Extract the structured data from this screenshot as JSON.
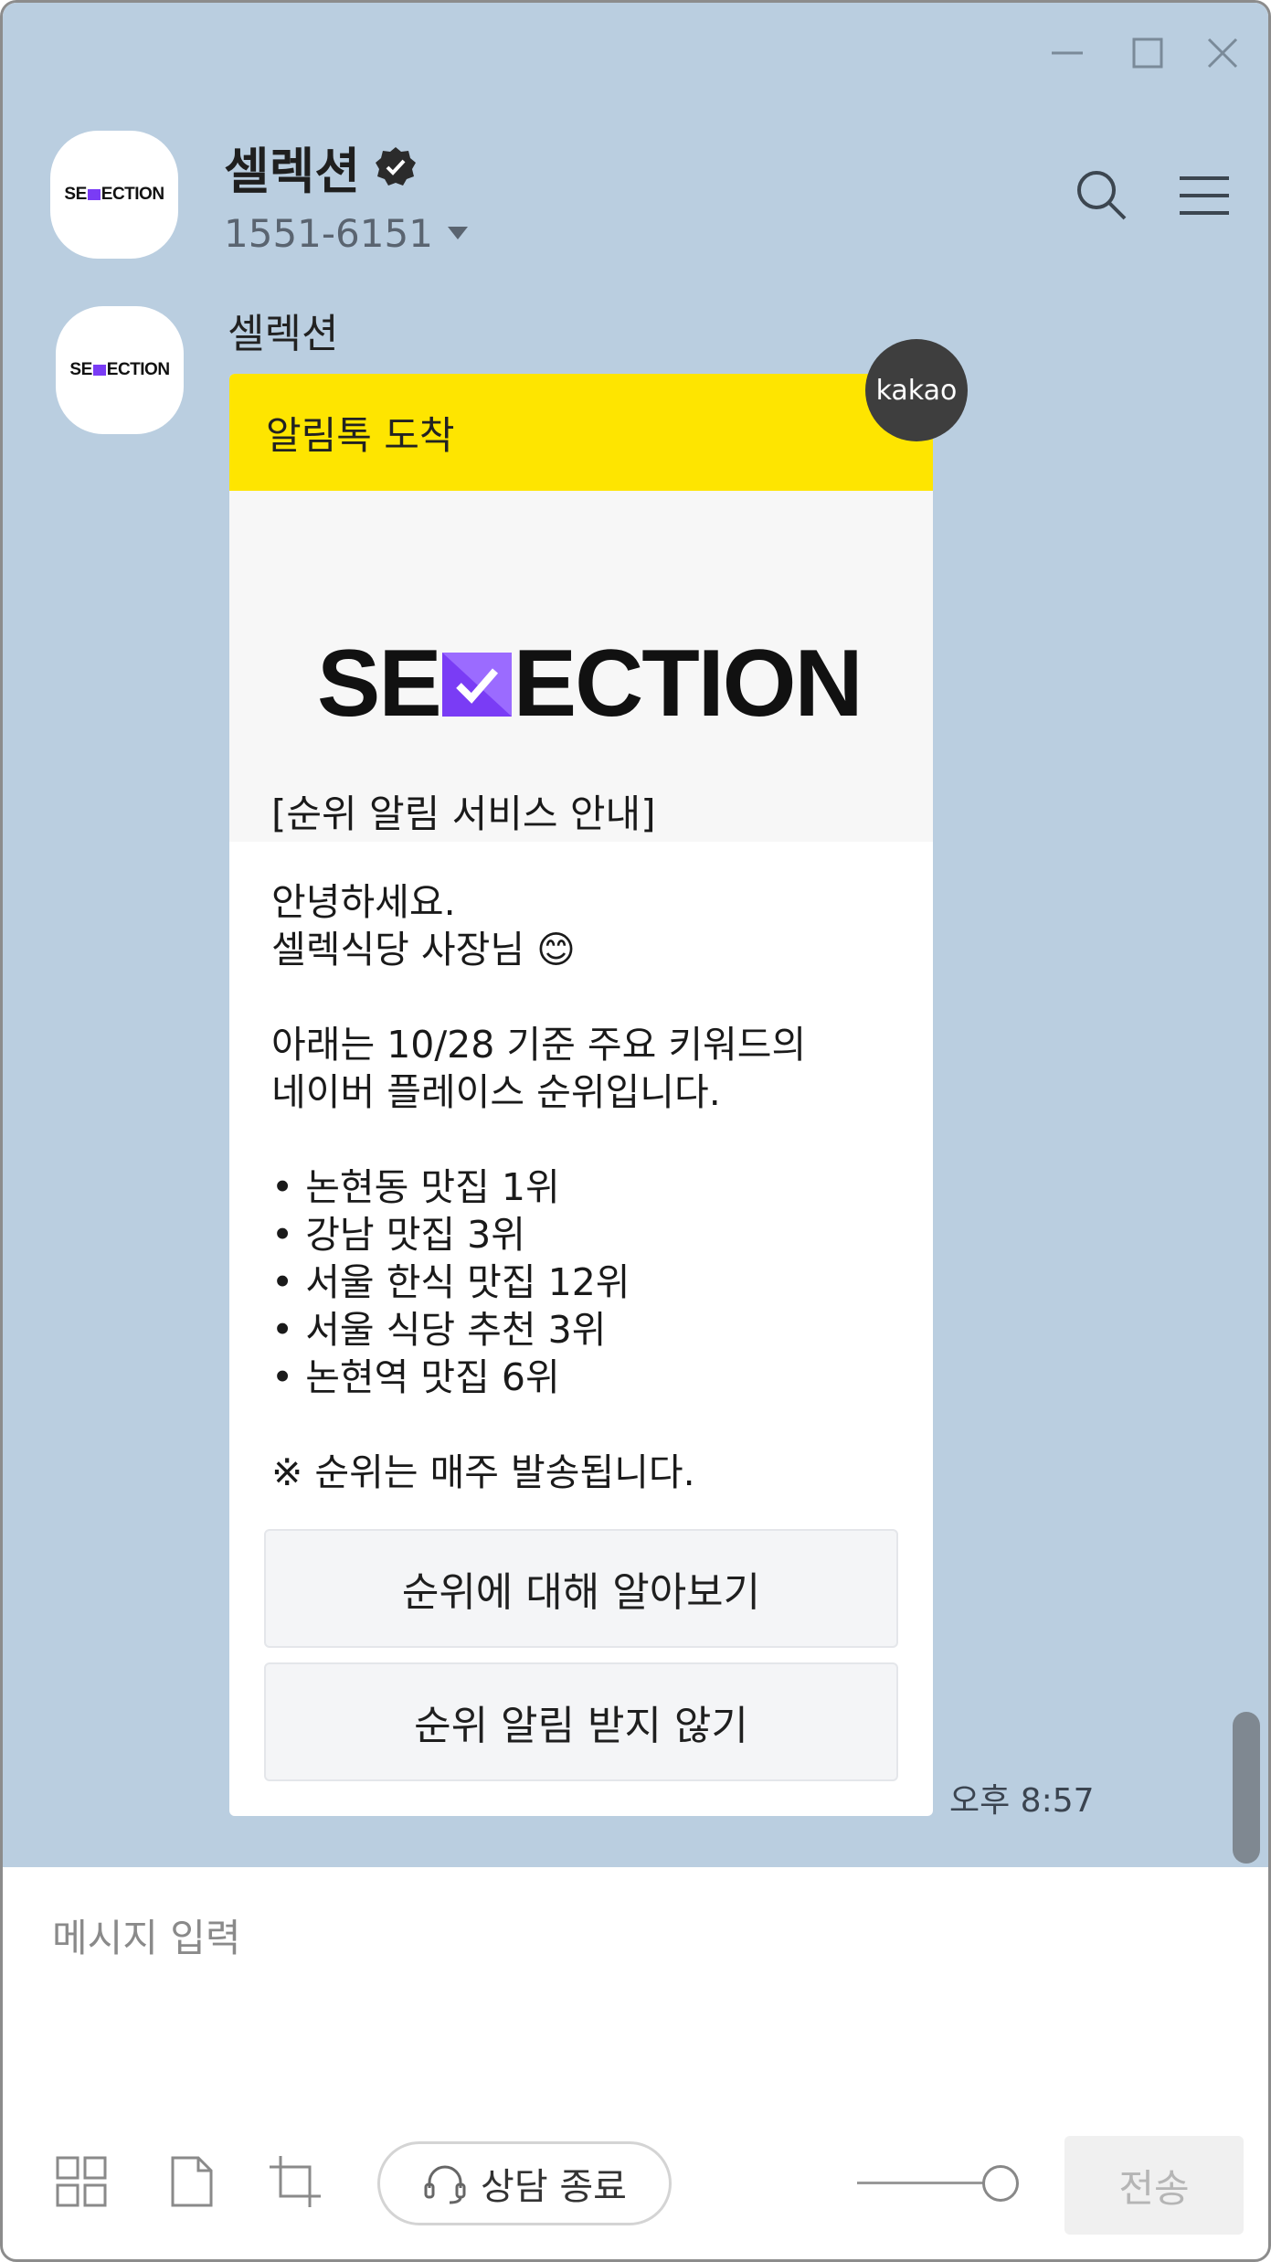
{
  "header": {
    "title": "셀렉션",
    "phone": "1551-6151",
    "verified_icon": "verified-check-icon"
  },
  "message": {
    "sender": "셀렉션",
    "card_header": "알림톡 도착",
    "badge": "kakao",
    "logo_left": "SE",
    "logo_right": "ECTION",
    "notice_title": "[순위 알림 서비스 안내]",
    "body_lines": {
      "l1": "안녕하세요.",
      "l2": "셀렉식당 사장님 😊",
      "l3": "아래는 10/28 기준 주요 키워드의",
      "l4": "네이버 플레이스 순위입니다.",
      "b1": "• 논현동 맛집 1위",
      "b2": "• 강남 맛집 3위",
      "b3": "• 서울 한식 맛집 12위",
      "b4": "• 서울 식당 추천 3위",
      "b5": "• 논현역 맛집 6위",
      "note": "※ 순위는 매주 발송됩니다."
    },
    "button1": "순위에 대해 알아보기",
    "button2": "순위 알림 받지 않기",
    "time": "오후 8:57"
  },
  "composer": {
    "placeholder": "메시지 입력",
    "end_consult": "상담 종료",
    "send": "전송"
  },
  "colors": {
    "chat_bg": "#bacee0",
    "kakao_yellow": "#fee500",
    "logo_purple": "#7a3cf5"
  }
}
